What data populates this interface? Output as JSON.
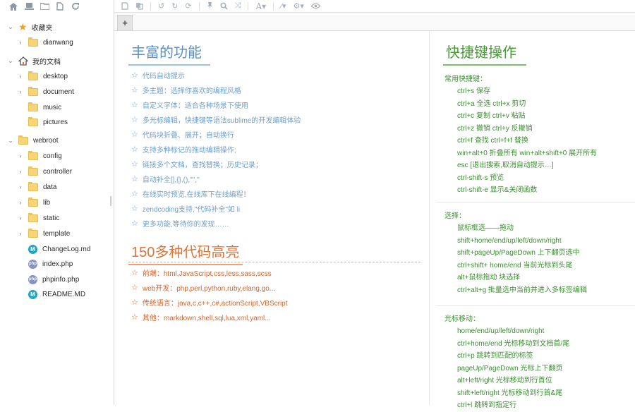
{
  "sidebar": {
    "toolbar_icons": [
      "home-icon",
      "laptop-icon",
      "folder-icon",
      "file-icon",
      "refresh-icon"
    ],
    "tree": [
      {
        "label": "收藏夹",
        "type": "favorites",
        "depth": 0,
        "expanded": true
      },
      {
        "label": "dianwang",
        "type": "folder",
        "depth": 1,
        "expandable": true
      },
      {
        "label": "我的文档",
        "type": "home",
        "depth": 0,
        "expanded": true
      },
      {
        "label": "desktop",
        "type": "folder",
        "depth": 1,
        "expandable": true
      },
      {
        "label": "document",
        "type": "folder",
        "depth": 1,
        "expandable": true
      },
      {
        "label": "music",
        "type": "folder",
        "depth": 1,
        "expandable": false
      },
      {
        "label": "pictures",
        "type": "folder",
        "depth": 1,
        "expandable": false
      },
      {
        "label": "webroot",
        "type": "folder",
        "depth": 0,
        "expanded": true
      },
      {
        "label": "config",
        "type": "folder",
        "depth": 1,
        "expandable": true
      },
      {
        "label": "controller",
        "type": "folder",
        "depth": 1,
        "expandable": true
      },
      {
        "label": "data",
        "type": "folder",
        "depth": 1,
        "expandable": true
      },
      {
        "label": "lib",
        "type": "folder",
        "depth": 1,
        "expandable": true
      },
      {
        "label": "static",
        "type": "folder",
        "depth": 1,
        "expandable": true
      },
      {
        "label": "template",
        "type": "folder",
        "depth": 1,
        "expandable": true
      },
      {
        "label": "ChangeLog.md",
        "type": "md",
        "depth": 1,
        "expandable": false
      },
      {
        "label": "index.php",
        "type": "php",
        "depth": 1,
        "expandable": false
      },
      {
        "label": "phpinfo.php",
        "type": "php",
        "depth": 1,
        "expandable": false
      },
      {
        "label": "README.MD",
        "type": "md",
        "depth": 1,
        "expandable": false
      }
    ]
  },
  "editor": {
    "toolbar_icons": [
      "save-icon",
      "copy-icon",
      "undo-icon",
      "redo-icon",
      "refresh-icon",
      "pin-icon",
      "search-icon",
      "shuffle-icon",
      "font-icon",
      "magic-wand-icon",
      "gear-icon",
      "eye-icon"
    ],
    "add_tab_label": "+"
  },
  "features": {
    "title": "丰富的功能",
    "items": [
      "代码自动提示",
      "多主题：选择你喜欢的编程风格",
      "自定义字体：适合各种场景下使用",
      "多光标编辑，快捷键等语法sublime的开发编辑体验",
      "代码块折叠、展开；自动换行",
      "支持多种标记的拖动编辑操作;",
      "链接多个文档，查找替换；历史记录；",
      "自动补全[],{},(),\"\",''",
      "在线实时预览,在线库下在线编程！",
      "zendcoding支持,\"代码补全\"如 li",
      "更多功能,等待你的发现……"
    ]
  },
  "languages": {
    "title": "150多种代码高亮",
    "items": [
      "前端：html,JavaScript,css,less,sass,scss",
      "web开发：php,perl,python,ruby,elang,go...",
      "传统语言：java,c,c++,c#,actionScript,VBScript",
      "其他：markdown,shell,sql,lua,xml,yaml..."
    ]
  },
  "shortcuts": {
    "title": "快捷键操作",
    "groups": [
      {
        "heading": "常用快捷键：",
        "items": [
          "ctrl+s 保存",
          "ctrl+a 全选      ctrl+x 剪切",
          "ctrl+c 复制      ctrl+v 粘贴",
          "ctrl+z 撤销      ctrl+y 反撤销",
          "ctrl+f 查找      ctrl+f+f 替换",
          "win+alt+0 折叠所有     win+alt+shift+0 展开所有",
          "esc [退出搜索,取消自动提示…]",
          "ctrl-shift-s  预览",
          "ctrl-shift-e  显示&关闭函数"
        ]
      },
      {
        "heading": "选择：",
        "items": [
          "鼠标框选——拖动",
          "shift+home/end/up/left/down/right",
          "shift+pageUp/PageDown  上下翻页选中",
          "ctrl+shift+ home/end  当前光标到头尾",
          "alt+鼠标拖动  块选择",
          "ctrl+alt+g  批量选中当前并进入多标签编辑"
        ]
      },
      {
        "heading": "光标移动：",
        "items": [
          "home/end/up/left/down/right",
          "ctrl+home/end 光标移动到文档首/尾",
          "ctrl+p  跳转到匹配的标签",
          "pageUp/PageDown 光标上下翻页",
          "alt+left/right 光标移动到行首位",
          "shift+left/right  光标移动到行首&尾",
          "ctrl+l 跳转到指定行"
        ]
      }
    ]
  },
  "colors": {
    "blue": "#6f9ec9",
    "orange": "#d8632b",
    "green": "#3c8f32",
    "folder": "#f6d477"
  }
}
